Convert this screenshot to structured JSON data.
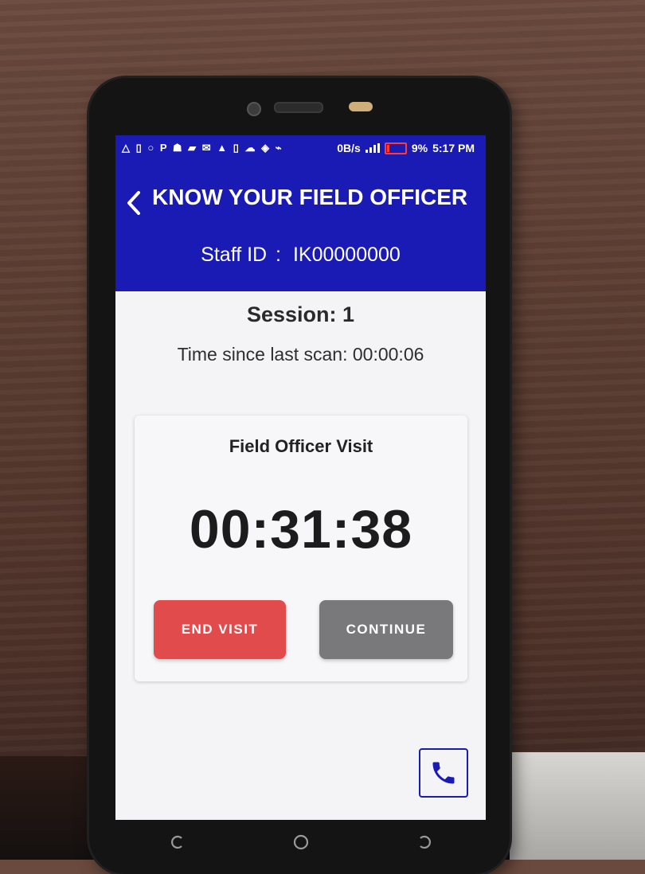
{
  "status_bar": {
    "left_icons": "△ ▯ ○ P ☗ ▰ ✉ ▲ ▯ ☁ ◈ ⌁",
    "net_speed": "0B/s",
    "battery_percent": "9%",
    "time": "5:17 PM",
    "battery_color": "#ff3a3a"
  },
  "header": {
    "back_icon": "chevron-left-icon",
    "title": "KNOW YOUR FIELD OFFICER",
    "staff_label": "Staff ID",
    "staff_separator": ":",
    "staff_id": "IK00000000",
    "background": "#1a1ab4"
  },
  "session": {
    "label": "Session: 1",
    "time_since_label": "Time since last scan: 00:00:06"
  },
  "visit_card": {
    "title": "Field Officer Visit",
    "timer": "00:31:38",
    "end_button": "END VISIT",
    "continue_button": "CONTINUE",
    "end_color": "#e24b4b",
    "continue_color": "#79797c"
  },
  "call_button": {
    "icon": "phone-icon"
  },
  "nav": {
    "recents_icon": "recents-icon",
    "home_icon": "home-icon",
    "back_icon": "back-icon"
  }
}
